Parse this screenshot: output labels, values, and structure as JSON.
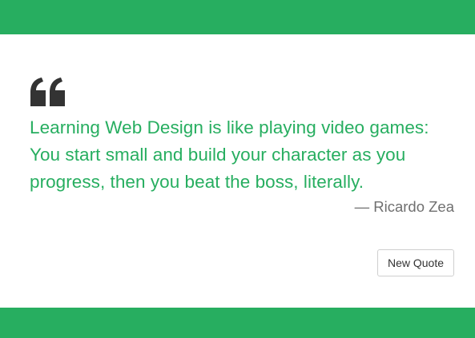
{
  "colors": {
    "accent": "#27ae60",
    "quote_text": "#27ae60",
    "author_text": "#6f6f6f",
    "button_text": "#333333",
    "icon": "#333333"
  },
  "quote": {
    "icon": "left-quote-icon",
    "text": "Learning Web Design is like playing video games: You start small and build your character as you progress, then you beat the boss, literally.",
    "author": "— Ricardo Zea"
  },
  "actions": {
    "new_quote_label": "New Quote"
  }
}
